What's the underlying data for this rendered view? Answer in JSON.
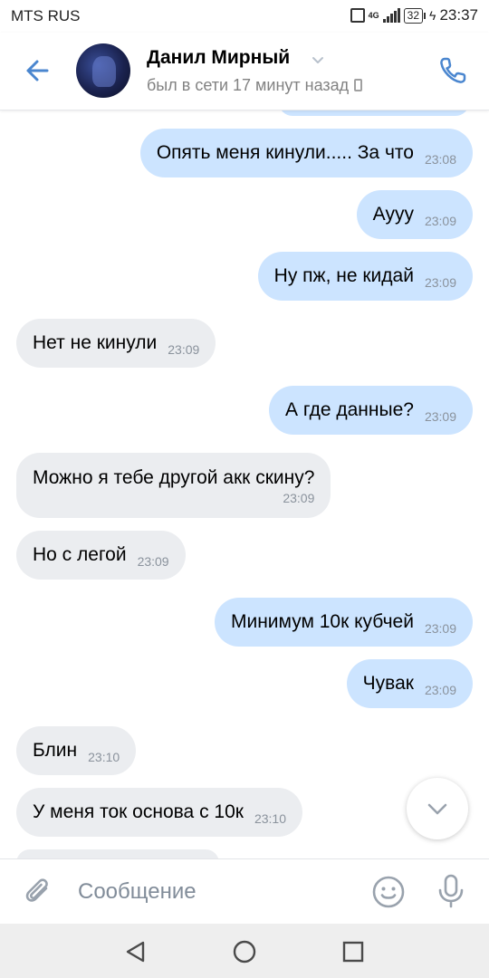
{
  "status_bar": {
    "carrier": "MTS RUS",
    "network": "4G",
    "battery": "32",
    "time": "23:37"
  },
  "header": {
    "contact_name": "Данил Мирный",
    "status": "был в сети 17 минут назад",
    "icons": {
      "back": "arrow-left-icon",
      "call": "phone-icon",
      "dropdown": "chevron-down-icon",
      "device": "mobile-icon"
    }
  },
  "messages": [
    {
      "text": "Опять меня кинули..... За что",
      "time": "23:08",
      "direction": "out"
    },
    {
      "text": "Аууу",
      "time": "23:09",
      "direction": "out"
    },
    {
      "text": "Ну пж, не кидай",
      "time": "23:09",
      "direction": "out"
    },
    {
      "text": "Нет не кинули",
      "time": "23:09",
      "direction": "in"
    },
    {
      "text": "А где данные?",
      "time": "23:09",
      "direction": "out"
    },
    {
      "text": "Можно я тебе другой акк скину?",
      "time": "23:09",
      "direction": "in"
    },
    {
      "text": "Но с легой",
      "time": "23:09",
      "direction": "in"
    },
    {
      "text": "Минимум 10к кубчей",
      "time": "23:09",
      "direction": "out"
    },
    {
      "text": "Чувак",
      "time": "23:09",
      "direction": "out"
    },
    {
      "text": "Блин",
      "time": "23:10",
      "direction": "in"
    },
    {
      "text": "У меня ток основа с 10к",
      "time": "23:10",
      "direction": "in"
    }
  ],
  "composer": {
    "placeholder": "Сообщение",
    "icons": {
      "attach": "paperclip-icon",
      "emoji": "smiley-icon",
      "voice": "microphone-icon",
      "scroll_down": "chevron-down-icon"
    }
  },
  "nav_bar": {
    "icons": [
      "triangle-back-icon",
      "circle-home-icon",
      "square-recents-icon"
    ]
  },
  "colors": {
    "accent": "#4a86cf",
    "outgoing_bubble": "#cce4ff",
    "incoming_bubble": "#ebedf0",
    "time_text": "#8a929c",
    "secondary_text": "#828282"
  }
}
